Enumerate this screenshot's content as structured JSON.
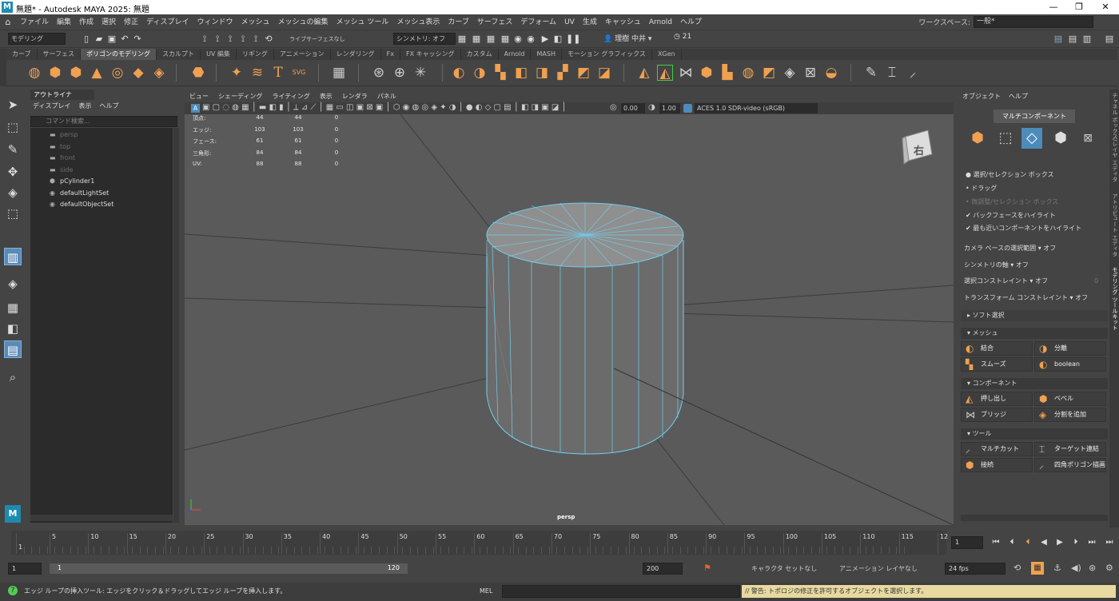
{
  "window": {
    "title": "無題* - Autodesk MAYA 2025: 無題",
    "logo": "M"
  },
  "menu": [
    "ファイル",
    "編集",
    "作成",
    "選択",
    "修正",
    "ディスプレイ",
    "ウィンドウ",
    "メッシュ",
    "メッシュの編集",
    "メッシュ ツール",
    "メッシュ表示",
    "カーブ",
    "サーフェス",
    "デフォーム",
    "UV",
    "生成",
    "キャッシュ",
    "Arnold",
    "ヘルプ"
  ],
  "workspace": {
    "label": "ワークスペース:",
    "value": "一般*"
  },
  "statusline": {
    "mode": "モデリング",
    "live": "ライブ",
    "live_value": "サーフェスなし",
    "symmetry": "シンメトリ: オフ",
    "user": "理樹 中井",
    "notifications": "21"
  },
  "shelf_tabs": [
    "カーブ",
    "サーフェス",
    "ポリゴンのモデリング",
    "スカルプト",
    "UV 編集",
    "リギング",
    "アニメーション",
    "レンダリング",
    "Fx",
    "FX キャッシング",
    "カスタム",
    "Arnold",
    "MASH",
    "モーション グラフィックス",
    "XGen"
  ],
  "shelf_active": "ポリゴンのモデリング",
  "outliner": {
    "tab": "アウトライナ",
    "menu": [
      "ディスプレイ",
      "表示",
      "ヘルプ"
    ],
    "search_placeholder": "コマンド検索...",
    "items": [
      {
        "label": "persp",
        "dim": true
      },
      {
        "label": "top",
        "dim": true
      },
      {
        "label": "front",
        "dim": true
      },
      {
        "label": "side",
        "dim": true
      },
      {
        "label": "pCylinder1",
        "dim": false
      },
      {
        "label": "defaultLightSet",
        "dim": false
      },
      {
        "label": "defaultObjectSet",
        "dim": false
      }
    ]
  },
  "viewport": {
    "menu": [
      "ビュー",
      "シェーディング",
      "ライティング",
      "表示",
      "レンダラ",
      "パネル"
    ],
    "exposure": "0.00",
    "gamma": "1.00",
    "colorspace": "ACES 1.0 SDR-video (sRGB)",
    "camera": "persp",
    "viewcube_label": "右",
    "hud": [
      {
        "label": "頂点:",
        "a": "44",
        "b": "44",
        "c": "0"
      },
      {
        "label": "エッジ:",
        "a": "103",
        "b": "103",
        "c": "0"
      },
      {
        "label": "フェース:",
        "a": "61",
        "b": "61",
        "c": "0"
      },
      {
        "label": "三角形:",
        "a": "84",
        "b": "84",
        "c": "0"
      },
      {
        "label": "UV:",
        "a": "88",
        "b": "88",
        "c": "0"
      }
    ]
  },
  "modeling_toolkit": {
    "menu": [
      "オブジェクト",
      "ヘルプ"
    ],
    "multi_component": "マルチコンポーネント",
    "radio": [
      "選択/セレクション ボックス",
      "ドラッグ",
      "微調整/セレクション ボックス"
    ],
    "checks": [
      "バックフェースをハイライト",
      "最も近いコンポーネントをハイライト"
    ],
    "options": [
      {
        "label": "カメラ ベースの選択範囲",
        "value": "オフ"
      },
      {
        "label": "シンメトリの軸",
        "value": "オフ"
      },
      {
        "label": "選択コンストレイント",
        "value": "オフ",
        "extra": "0"
      },
      {
        "label": "トランスフォーム コンストレイント",
        "value": "オフ"
      }
    ],
    "soft_select": "ソフト選択",
    "sections": {
      "mesh": {
        "title": "メッシュ",
        "buttons": [
          "結合",
          "分離",
          "スムーズ",
          "boolean"
        ]
      },
      "component": {
        "title": "コンポーネント",
        "buttons": [
          "押し出し",
          "ベベル",
          "ブリッジ",
          "分割を追加"
        ]
      },
      "tool": {
        "title": "ツール",
        "buttons": [
          "マルチカット",
          "ターゲット連結",
          "接続",
          "四角ポリゴン描画"
        ]
      }
    },
    "side_tabs": [
      "チャネル ボックス/レイヤ エディタ",
      "アトリビュート エディタ",
      "モデリング ツールキット"
    ]
  },
  "timeline": {
    "ticks": [
      "1",
      "5",
      "10",
      "15",
      "20",
      "25",
      "30",
      "35",
      "40",
      "45",
      "50",
      "55",
      "60",
      "65",
      "70",
      "75",
      "80",
      "85",
      "90",
      "95",
      "100",
      "105",
      "110",
      "115",
      "12"
    ],
    "current": "1"
  },
  "range": {
    "start": "1",
    "inner_start": "1",
    "inner_end": "120",
    "end": "200",
    "character": "キャラクタ セットなし",
    "anim_layer": "アニメーション レイヤなし",
    "fps": "24 fps"
  },
  "help": {
    "text": "エッジ ループの挿入ツール: エッジをクリック＆ドラッグしてエッジ ループを挿入します。",
    "mel": "MEL",
    "warning": "// 警告: トポロジの修正を許可するオブジェクトを選択します。"
  }
}
